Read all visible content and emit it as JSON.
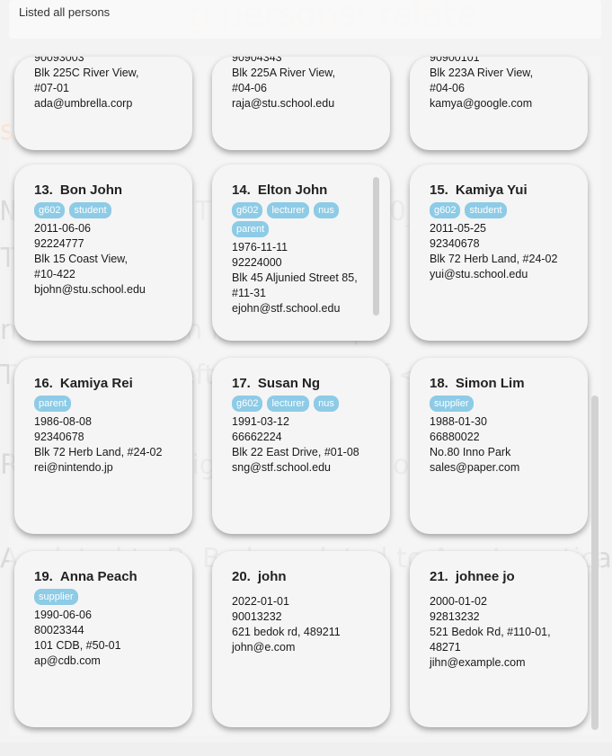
{
  "result": {
    "message": "Listed all persons"
  },
  "persons": [
    {
      "lines": [
        "90093003",
        "Blk 225C River View,",
        "#07-01",
        "ada@umbrella.corp"
      ]
    },
    {
      "lines": [
        "90904343",
        "Blk 225A River View,",
        "#04-06",
        "raja@stu.school.edu"
      ]
    },
    {
      "lines": [
        "90900101",
        "Blk 223A River View,",
        "#04-06",
        "kamya@google.com"
      ]
    },
    {
      "index": "13.",
      "name": "Bon John",
      "tags": [
        "g602",
        "student"
      ],
      "lines": [
        "2011-06-06",
        "92224777",
        "Blk 15 Coast View,",
        "#10-422",
        "bjohn@stu.school.edu"
      ]
    },
    {
      "index": "14.",
      "name": "Elton John",
      "tags": [
        "g602",
        "lecturer",
        "nus",
        "parent"
      ],
      "lines": [
        "1976-11-11",
        "92224000",
        "Blk 45 Aljunied Street 85,",
        "#11-31",
        "ejohn@stf.school.edu"
      ]
    },
    {
      "index": "15.",
      "name": "Kamiya Yui",
      "tags": [
        "g602",
        "student"
      ],
      "lines": [
        "2011-05-25",
        "92340678",
        "Blk 72 Herb Land, #24-02",
        "yui@stu.school.edu"
      ]
    },
    {
      "index": "16.",
      "name": "Kamiya Rei",
      "tags": [
        "parent"
      ],
      "lines": [
        "1986-08-08",
        "92340678",
        "Blk 72 Herb Land, #24-02",
        "rei@nintendo.jp"
      ]
    },
    {
      "index": "17.",
      "name": "Susan Ng",
      "tags": [
        "g602",
        "lecturer",
        "nus"
      ],
      "lines": [
        "1991-03-12",
        "66662224",
        "Blk 22 East Drive, #01-08",
        "sng@stf.school.edu"
      ]
    },
    {
      "index": "18.",
      "name": "Simon Lim",
      "tags": [
        "supplier"
      ],
      "lines": [
        "1988-01-30",
        "66880022",
        "No.80 Inno Park",
        "sales@paper.com"
      ]
    },
    {
      "index": "19.",
      "name": "Anna Peach",
      "tags": [
        "supplier"
      ],
      "lines": [
        "1990-06-06",
        "80023344",
        "101 CDB, #50-01",
        "ap@cdb.com"
      ]
    },
    {
      "index": "20.",
      "name": "john",
      "tags": [],
      "lines": [
        "2022-01-01",
        "90013232",
        "621 bedok rd, 489211",
        "john@e.com"
      ]
    },
    {
      "index": "21.",
      "name": "johnee jo",
      "tags": [],
      "lines": [
        "2000-01-02",
        "92813232",
        "521 Bedok Rd, #110-01,",
        "48271",
        "jihn@example.com"
      ]
    }
  ],
  "background_text": [
    "g persons:  relate",
    "s to someone",
    "NO_OF_CONTACT  FROM_SEQ_NO_OF_CONT",
    "T2",
    "nd has a 1 to n relationship",
    "TACT on the left hand side of  <-  is the targ",
    "RSON on the right hand side of  ->  is the",
    "A related to B, B also related to A automatical"
  ],
  "colors": {
    "tag": "#8dcbe6",
    "card": "#f5f5f5",
    "background": "#f3f3f3"
  }
}
